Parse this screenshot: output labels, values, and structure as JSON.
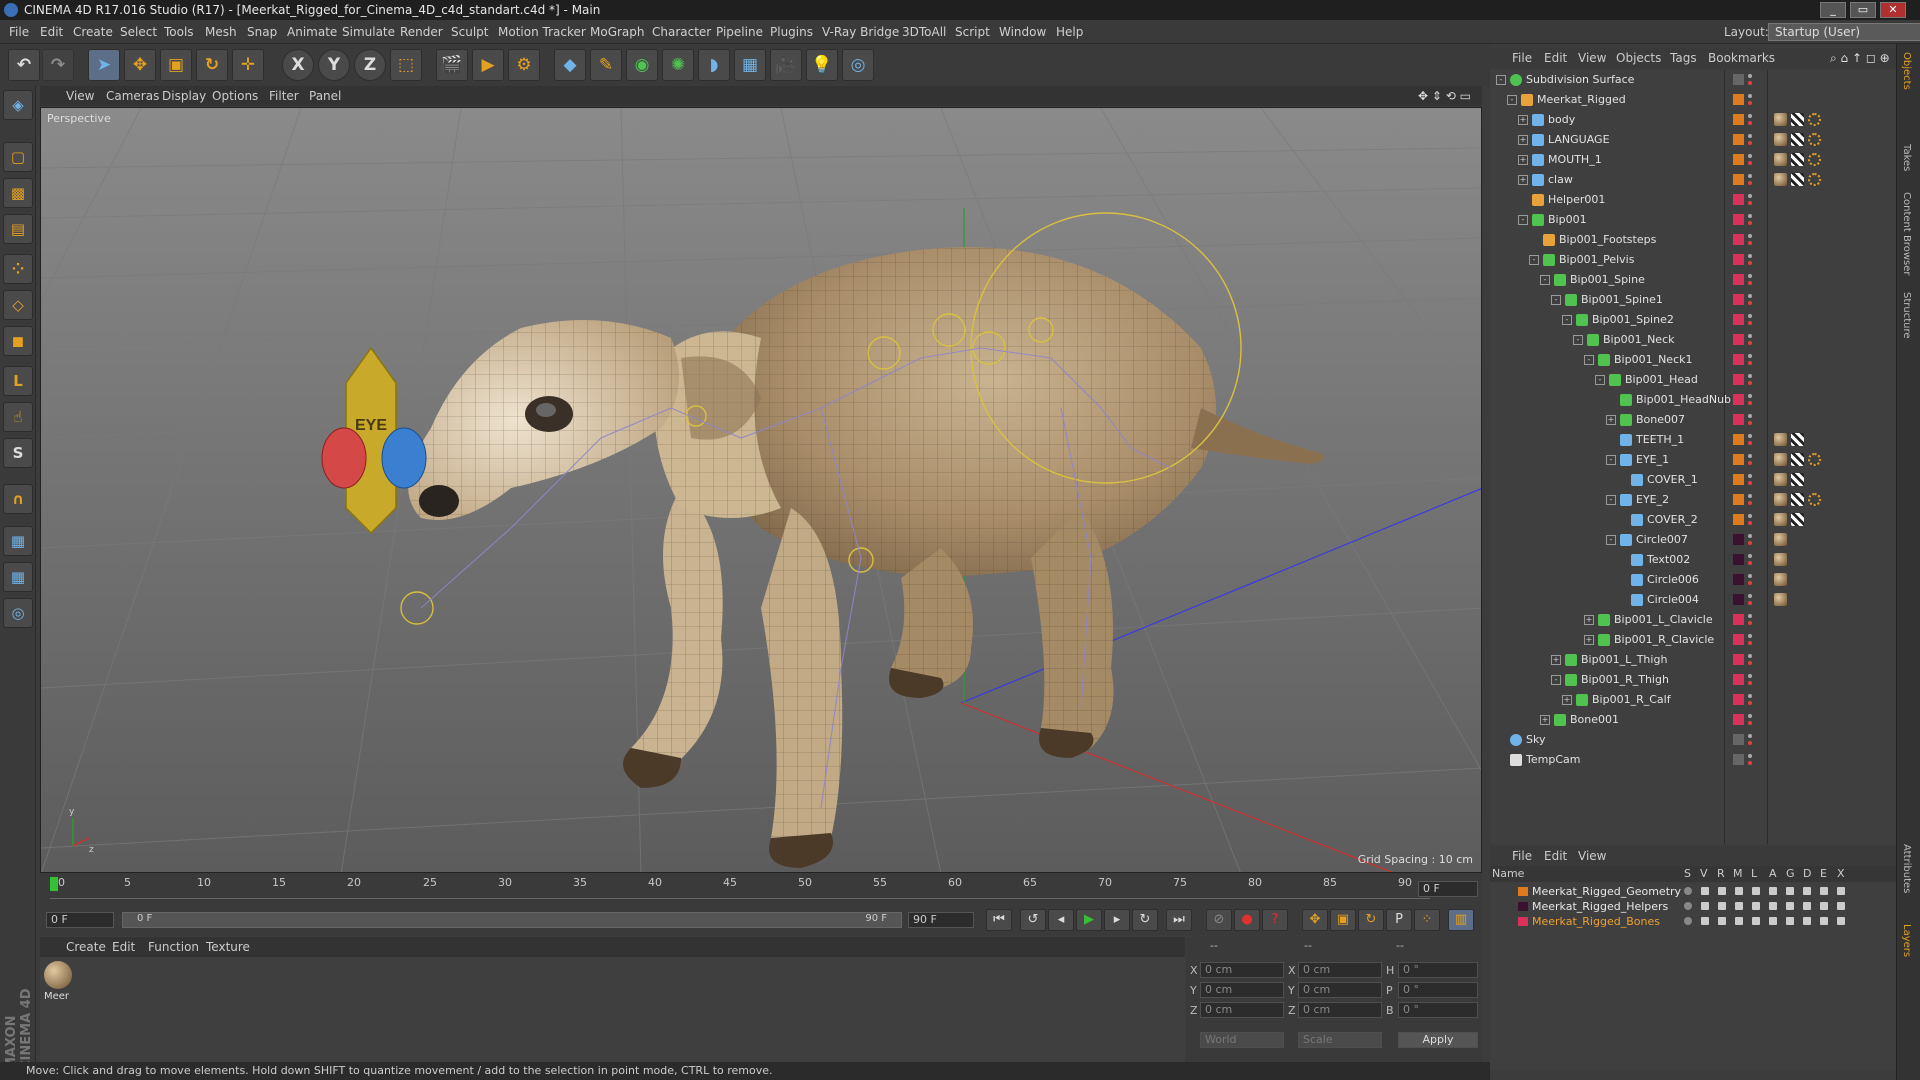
{
  "window": {
    "title": "CINEMA 4D R17.016 Studio (R17) - [Meerkat_Rigged_for_Cinema_4D_c4d_standart.c4d *] - Main",
    "buttons": [
      "_",
      "▭",
      "✕"
    ]
  },
  "menubar": {
    "items": [
      "File",
      "Edit",
      "Create",
      "Select",
      "Tools",
      "Mesh",
      "Snap",
      "Animate",
      "Simulate",
      "Render",
      "Sculpt",
      "Motion Tracker",
      "MoGraph",
      "Character",
      "Pipeline",
      "Plugins",
      "V-Ray Bridge",
      "3DToAll",
      "Script",
      "Window",
      "Help"
    ],
    "layout_label": "Layout:",
    "layout_value": "Startup (User)"
  },
  "toolbar": {
    "x_axis": "X",
    "y_axis": "Y",
    "z_axis": "Z"
  },
  "viewport": {
    "menu": [
      "View",
      "Cameras",
      "Display",
      "Options",
      "Filter",
      "Panel"
    ],
    "label": "Perspective",
    "grid_spacing": "Grid Spacing : 10 cm",
    "eye_controller": "EYE",
    "axis_y": "y",
    "axis_z": "z"
  },
  "timeline": {
    "ticks": [
      "0",
      "5",
      "10",
      "15",
      "20",
      "25",
      "30",
      "35",
      "40",
      "45",
      "50",
      "55",
      "60",
      "65",
      "70",
      "75",
      "80",
      "85",
      "90"
    ],
    "current_frame": "0 F"
  },
  "playback": {
    "start": "0 F",
    "slider_start": "0 F",
    "slider_end": "90 F",
    "end": "90 F"
  },
  "material_manager": {
    "menu": [
      "Create",
      "Edit",
      "Function",
      "Texture"
    ],
    "material_name": "Meer"
  },
  "coordinates": {
    "header": [
      "--",
      "--",
      "--"
    ],
    "rows": [
      {
        "a": "X",
        "av": "0 cm",
        "b": "X",
        "bv": "0 cm",
        "c": "H",
        "cv": "0 °"
      },
      {
        "a": "Y",
        "av": "0 cm",
        "b": "Y",
        "bv": "0 cm",
        "c": "P",
        "cv": "0 °"
      },
      {
        "a": "Z",
        "av": "0 cm",
        "b": "Z",
        "bv": "0 cm",
        "c": "B",
        "cv": "0 °"
      }
    ],
    "mode": "World",
    "scale": "Scale",
    "apply": "Apply"
  },
  "status": {
    "text": "Move: Click and drag to move elements. Hold down SHIFT to quantize movement / add to the selection in point mode, CTRL to remove."
  },
  "object_manager": {
    "menu": [
      "File",
      "Edit",
      "View",
      "Objects",
      "Tags",
      "Bookmarks"
    ],
    "objects": [
      {
        "name": "Subdivision Surface",
        "depth": 0,
        "icon": "subdivision-icon",
        "color": "#4fc24f",
        "toggle": "-",
        "sw": "#666"
      },
      {
        "name": "Meerkat_Rigged",
        "depth": 1,
        "icon": "null-icon",
        "color": "#e8a23a",
        "toggle": "-",
        "sw": "#e07a1f"
      },
      {
        "name": "body",
        "depth": 2,
        "icon": "polygon-icon",
        "color": "#6fb3e8",
        "toggle": "+",
        "sw": "#e07a1f",
        "tags": 3
      },
      {
        "name": "LANGUAGE",
        "depth": 2,
        "icon": "polygon-icon",
        "color": "#6fb3e8",
        "toggle": "+",
        "sw": "#e07a1f",
        "tags": 3
      },
      {
        "name": "MOUTH_1",
        "depth": 2,
        "icon": "polygon-icon",
        "color": "#6fb3e8",
        "toggle": "+",
        "sw": "#e07a1f",
        "tags": 3
      },
      {
        "name": "claw",
        "depth": 2,
        "icon": "polygon-icon",
        "color": "#6fb3e8",
        "toggle": "+",
        "sw": "#e07a1f",
        "tags": 3
      },
      {
        "name": "Helper001",
        "depth": 2,
        "icon": "null-icon",
        "color": "#e8a23a",
        "toggle": "",
        "sw": "#d8325a"
      },
      {
        "name": "Bip001",
        "depth": 2,
        "icon": "bone-icon",
        "color": "#4fc24f",
        "toggle": "-",
        "sw": "#d8325a"
      },
      {
        "name": "Bip001_Footsteps",
        "depth": 3,
        "icon": "null-icon",
        "color": "#e8a23a",
        "toggle": "",
        "sw": "#d8325a"
      },
      {
        "name": "Bip001_Pelvis",
        "depth": 3,
        "icon": "bone-icon",
        "color": "#4fc24f",
        "toggle": "-",
        "sw": "#d8325a"
      },
      {
        "name": "Bip001_Spine",
        "depth": 4,
        "icon": "bone-icon",
        "color": "#4fc24f",
        "toggle": "-",
        "sw": "#d8325a"
      },
      {
        "name": "Bip001_Spine1",
        "depth": 5,
        "icon": "bone-icon",
        "color": "#4fc24f",
        "toggle": "-",
        "sw": "#d8325a"
      },
      {
        "name": "Bip001_Spine2",
        "depth": 6,
        "icon": "bone-icon",
        "color": "#4fc24f",
        "toggle": "-",
        "sw": "#d8325a"
      },
      {
        "name": "Bip001_Neck",
        "depth": 7,
        "icon": "bone-icon",
        "color": "#4fc24f",
        "toggle": "-",
        "sw": "#d8325a"
      },
      {
        "name": "Bip001_Neck1",
        "depth": 8,
        "icon": "bone-icon",
        "color": "#4fc24f",
        "toggle": "-",
        "sw": "#d8325a"
      },
      {
        "name": "Bip001_Head",
        "depth": 9,
        "icon": "bone-icon",
        "color": "#4fc24f",
        "toggle": "-",
        "sw": "#d8325a"
      },
      {
        "name": "Bip001_HeadNub",
        "depth": 10,
        "icon": "bone-icon",
        "color": "#4fc24f",
        "toggle": "",
        "sw": "#d8325a"
      },
      {
        "name": "Bone007",
        "depth": 10,
        "icon": "bone-icon",
        "color": "#4fc24f",
        "toggle": "+",
        "sw": "#d8325a"
      },
      {
        "name": "TEETH_1",
        "depth": 10,
        "icon": "polygon-icon",
        "color": "#6fb3e8",
        "toggle": "",
        "sw": "#e07a1f",
        "tags": 2
      },
      {
        "name": "EYE_1",
        "depth": 10,
        "icon": "polygon-icon",
        "color": "#6fb3e8",
        "toggle": "-",
        "sw": "#e07a1f",
        "tags": 3
      },
      {
        "name": "COVER_1",
        "depth": 11,
        "icon": "polygon-icon",
        "color": "#6fb3e8",
        "toggle": "",
        "sw": "#e07a1f",
        "tags": 2
      },
      {
        "name": "EYE_2",
        "depth": 10,
        "icon": "polygon-icon",
        "color": "#6fb3e8",
        "toggle": "-",
        "sw": "#e07a1f",
        "tags": 3
      },
      {
        "name": "COVER_2",
        "depth": 11,
        "icon": "polygon-icon",
        "color": "#6fb3e8",
        "toggle": "",
        "sw": "#e07a1f",
        "tags": 2
      },
      {
        "name": "Circle007",
        "depth": 10,
        "icon": "spline-icon",
        "color": "#6fb3e8",
        "toggle": "-",
        "sw": "#3a1230",
        "tags": 1
      },
      {
        "name": "Text002",
        "depth": 11,
        "icon": "spline-icon",
        "color": "#6fb3e8",
        "toggle": "",
        "sw": "#3a1230",
        "tags": 1
      },
      {
        "name": "Circle006",
        "depth": 11,
        "icon": "spline-icon",
        "color": "#6fb3e8",
        "toggle": "",
        "sw": "#3a1230",
        "tags": 1
      },
      {
        "name": "Circle004",
        "depth": 11,
        "icon": "spline-icon",
        "color": "#6fb3e8",
        "toggle": "",
        "sw": "#3a1230",
        "tags": 1
      },
      {
        "name": "Bip001_L_Clavicle",
        "depth": 8,
        "icon": "bone-icon",
        "color": "#4fc24f",
        "toggle": "+",
        "sw": "#d8325a"
      },
      {
        "name": "Bip001_R_Clavicle",
        "depth": 8,
        "icon": "bone-icon",
        "color": "#4fc24f",
        "toggle": "+",
        "sw": "#d8325a"
      },
      {
        "name": "Bip001_L_Thigh",
        "depth": 5,
        "icon": "bone-icon",
        "color": "#4fc24f",
        "toggle": "+",
        "sw": "#d8325a"
      },
      {
        "name": "Bip001_R_Thigh",
        "depth": 5,
        "icon": "bone-icon",
        "color": "#4fc24f",
        "toggle": "-",
        "sw": "#d8325a"
      },
      {
        "name": "Bip001_R_Calf",
        "depth": 6,
        "icon": "bone-icon",
        "color": "#4fc24f",
        "toggle": "+",
        "sw": "#d8325a"
      },
      {
        "name": "Bone001",
        "depth": 4,
        "icon": "bone-icon",
        "color": "#4fc24f",
        "toggle": "+",
        "sw": "#d8325a"
      },
      {
        "name": "Sky",
        "depth": 0,
        "icon": "sky-icon",
        "color": "#6fb3e8",
        "toggle": "",
        "sw": "#666"
      },
      {
        "name": "TempCam",
        "depth": 0,
        "icon": "camera-icon",
        "color": "#ddd",
        "toggle": "",
        "sw": "#666"
      }
    ]
  },
  "layer_manager": {
    "menu": [
      "File",
      "Edit",
      "View"
    ],
    "columns": [
      "Name",
      "S",
      "V",
      "R",
      "M",
      "L",
      "A",
      "G",
      "D",
      "E",
      "X"
    ],
    "layers": [
      {
        "name": "Meerkat_Rigged_Geometry",
        "color": "#e07a1f",
        "text_color": "#e8e8e8"
      },
      {
        "name": "Meerkat_Rigged_Helpers",
        "color": "#3a1230",
        "text_color": "#e8e8e8"
      },
      {
        "name": "Meerkat_Rigged_Bones",
        "color": "#d8325a",
        "text_color": "#f0a030"
      }
    ]
  },
  "right_tabs": [
    "Objects",
    "Takes",
    "Content Browser",
    "Structure",
    "Attributes",
    "Layers"
  ],
  "colors": {
    "accent_orange": "#e4a020",
    "accent_blue": "#6fb3e8",
    "viewport_bg": "#6d6d6d"
  }
}
